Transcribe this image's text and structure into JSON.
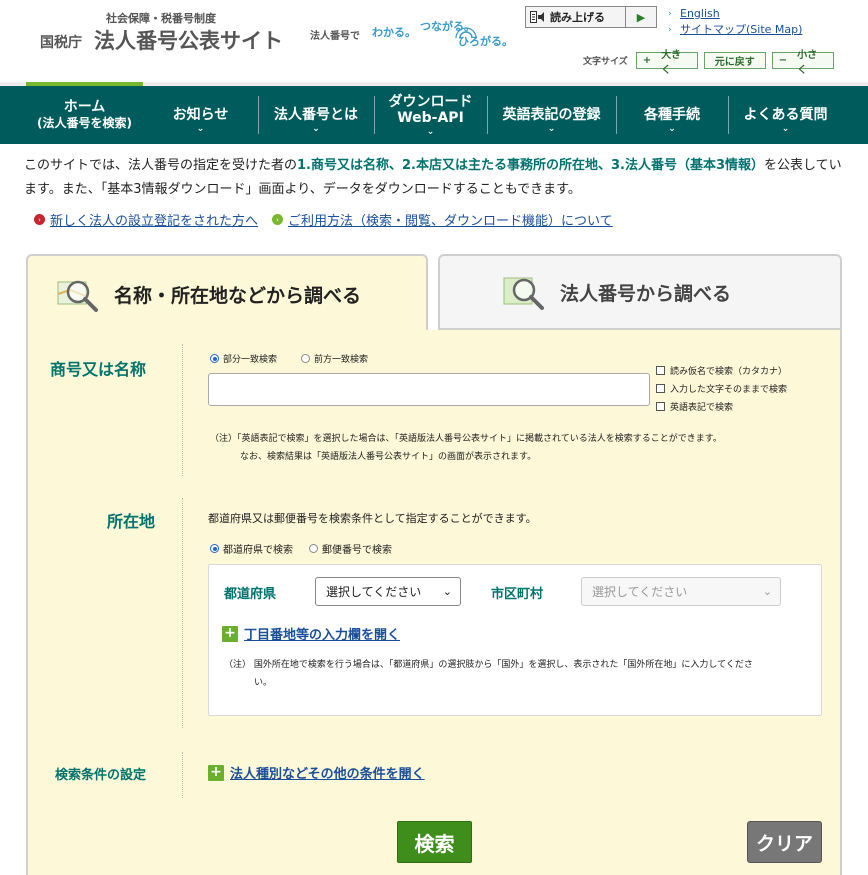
{
  "header": {
    "logo_sub": "社会保障・税番号制度",
    "logo_agency": "国税庁",
    "logo_main": "法人番号公表サイト",
    "tagline_prefix": "法人番号で",
    "tagline_wakaru": "わかる。",
    "tagline_tsunagaru": "つながる。",
    "tagline_hirogaru": "ひろがる。",
    "read_aloud": "読み上げる",
    "links": [
      "English",
      "サイトマップ(Site Map)"
    ],
    "font_size_label": "文字サイズ",
    "font_size_buttons": [
      {
        "sign": "+",
        "label": "大きく"
      },
      {
        "sign": "",
        "label": "元に戻す"
      },
      {
        "sign": "−",
        "label": "小さく"
      }
    ]
  },
  "nav": {
    "items": [
      {
        "line1": "ホーム",
        "line2": "(法人番号を検索)",
        "chevron": false
      },
      {
        "line1": "お知らせ",
        "line2": "",
        "chevron": true
      },
      {
        "line1": "法人番号とは",
        "line2": "",
        "chevron": true
      },
      {
        "line1": "ダウンロード",
        "line2": "Web-API",
        "chevron": true
      },
      {
        "line1": "英語表記の登録",
        "line2": "",
        "chevron": true
      },
      {
        "line1": "各種手続",
        "line2": "",
        "chevron": true
      },
      {
        "line1": "よくある質問",
        "line2": "",
        "chevron": true
      }
    ]
  },
  "intro": {
    "p1": "このサイトでは、法人番号の指定を受けた者の",
    "hl1": "1.商号又は名称、2.本店又は主たる事務所の所在地、3.法人番号（基本3情報）",
    "p2": "を公表しています。また、「基本3情報ダウンロード」画面より、データをダウンロードすることもできます。",
    "link1": "新しく法人の設立登記をされた方へ",
    "link2": "ご利用方法（検索・閲覧、ダウンロード機能）について"
  },
  "tabs": {
    "name_tab": "名称・所在地などから調べる",
    "number_tab": "法人番号から調べる"
  },
  "form": {
    "name_section": {
      "label": "商号又は名称",
      "radio_partial": "部分一致検索",
      "radio_prefix": "前方一致検索",
      "input_value": "",
      "checkboxes": [
        "読み仮名で検索（カタカナ）",
        "入力した文字そのままで検索",
        "英語表記で検索"
      ],
      "note_line1": "（注）「英語表記で検索」を選択した場合は、「英語版法人番号公表サイト」に掲載されている法人を検索することができます。",
      "note_line2": "なお、検索結果は「英語版法人番号公表サイト」の画面が表示されます。"
    },
    "address_section": {
      "label": "所在地",
      "description": "都道府県又は郵便番号を検索条件として指定することができます。",
      "radio_pref": "都道府県で検索",
      "radio_postal": "郵便番号で検索",
      "pref_label": "都道府県",
      "pref_select": "選択してください",
      "city_label": "市区町村",
      "city_select": "選択してください",
      "open_detail": "丁目番地等の入力欄を開く",
      "note_line1": "（注）  国外所在地で検索を行う場合は、「都道府県」の選択肢から「国外」を選択し、表示された「国外所在地」に入力してくださ",
      "note_line2": "い。"
    },
    "conditions_section": {
      "label": "検索条件の設定",
      "open_other": "法人種別などその他の条件を開く"
    },
    "search_button": "検索",
    "clear_button": "クリア"
  }
}
